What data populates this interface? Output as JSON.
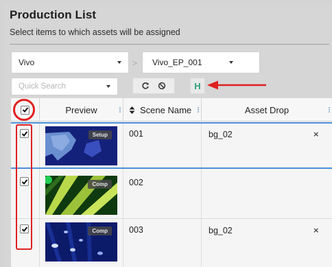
{
  "header": {
    "title": "Production List",
    "subtitle": "Select items to which assets will be assigned"
  },
  "filters": {
    "project": "Vivo",
    "episode": "Vivo_EP_001",
    "search_placeholder": "Quick Search"
  },
  "toolbar": {
    "refresh_icon": "refresh-icon",
    "clear_icon": "clear-icon",
    "h_label": "H"
  },
  "table": {
    "columns": {
      "preview": "Preview",
      "scene_name": "Scene Name",
      "asset_drop": "Asset Drop"
    },
    "rows": [
      {
        "selected": true,
        "badge": "Setup",
        "scene": "001",
        "asset": "bg_02",
        "remove": "×"
      },
      {
        "selected": true,
        "badge": "Comp",
        "scene": "002",
        "asset": "",
        "remove": ""
      },
      {
        "selected": true,
        "badge": "Comp",
        "scene": "003",
        "asset": "bg_02",
        "remove": "×"
      }
    ]
  },
  "colors": {
    "accent": "#4a90d9",
    "annotation": "#e02020",
    "h_button": "#2aa07a"
  }
}
